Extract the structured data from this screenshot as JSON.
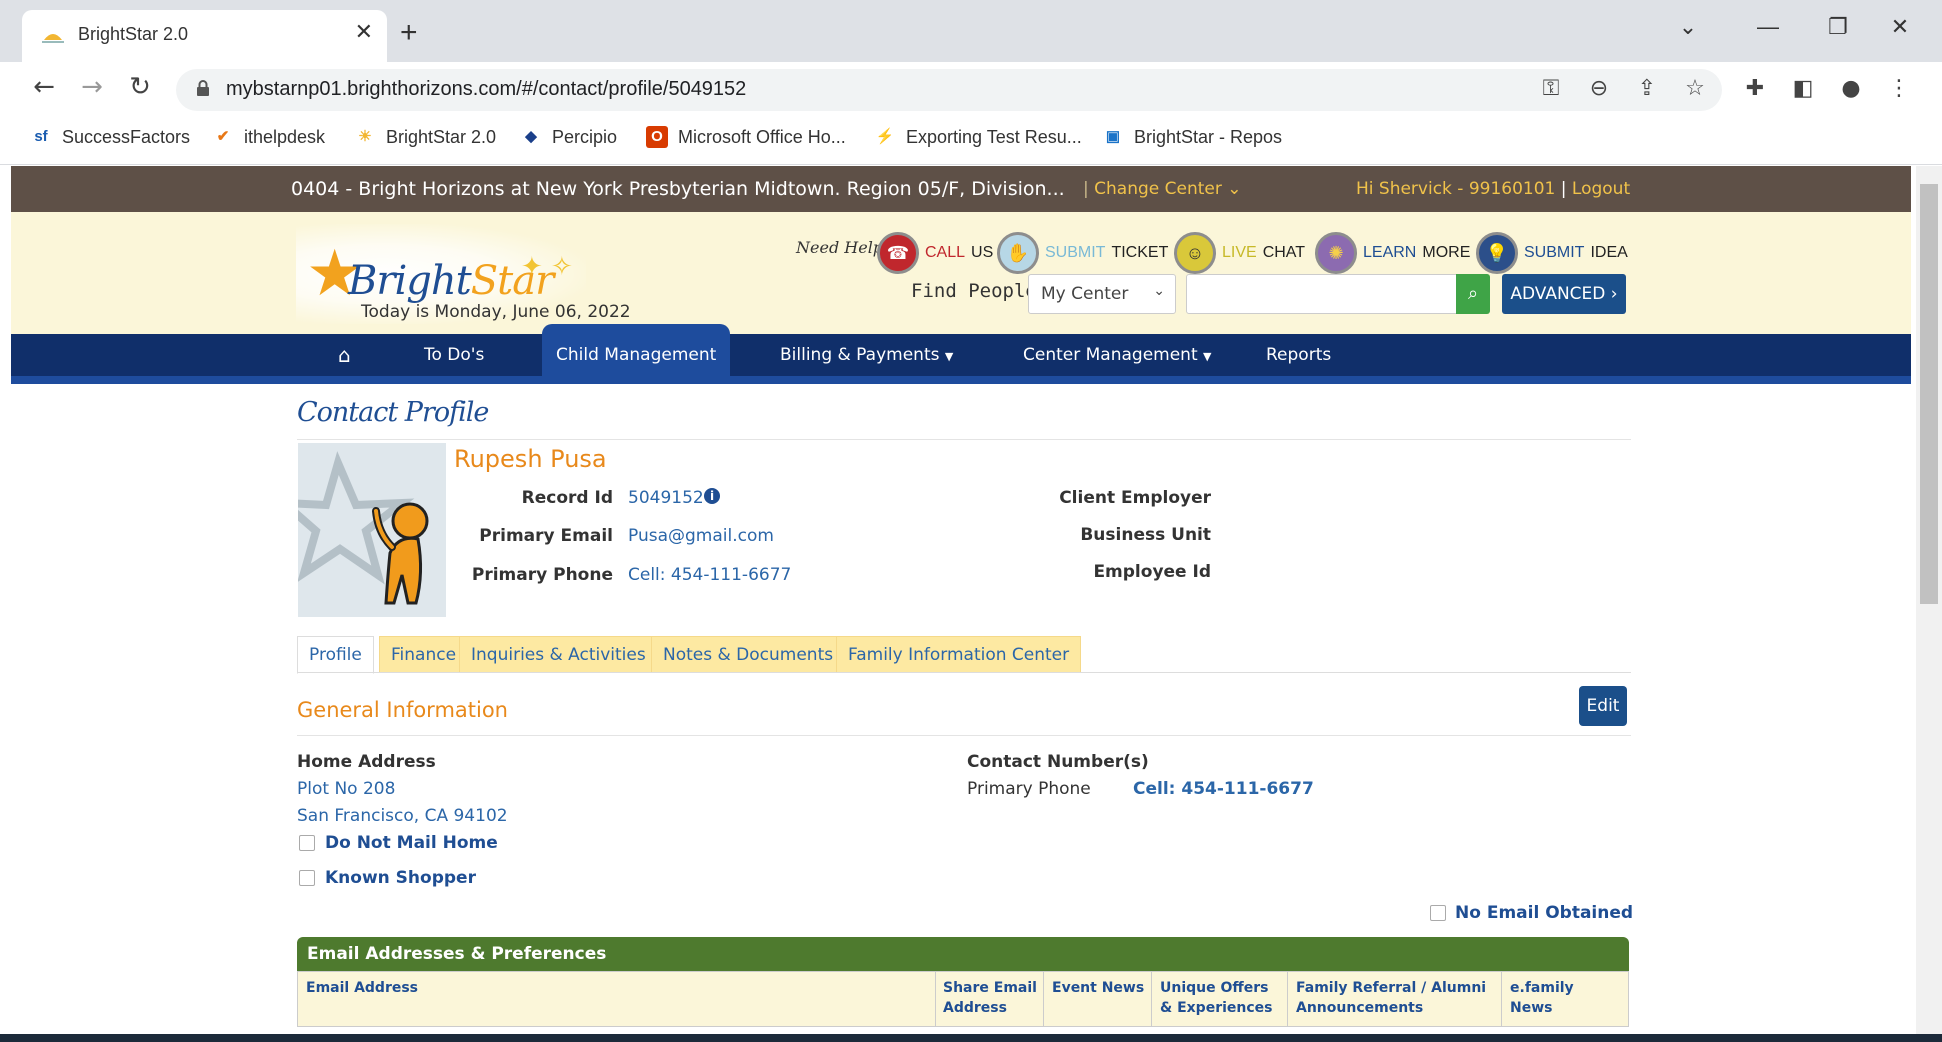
{
  "browser": {
    "tab_title": "BrightStar 2.0",
    "url": "mybstarnp01.brighthorizons.com/#/contact/profile/5049152",
    "bookmarks": [
      {
        "label": "SuccessFactors",
        "icon": "sf"
      },
      {
        "label": "ithelpdesk",
        "icon": "✔"
      },
      {
        "label": "BrightStar 2.0",
        "icon": "☀"
      },
      {
        "label": "Percipio",
        "icon": "◆"
      },
      {
        "label": "Microsoft Office Ho...",
        "icon": "O"
      },
      {
        "label": "Exporting Test Resu...",
        "icon": "⚡"
      },
      {
        "label": "BrightStar - Repos",
        "icon": "▣"
      }
    ]
  },
  "topbar": {
    "center": "0404 - Bright Horizons at New York Presbyterian Midtown. Region 05/F, Division...",
    "change_center": "Change Center",
    "greeting": "Hi Shervick - 99160101",
    "logout": "Logout"
  },
  "header": {
    "logo_bright": "Bright",
    "logo_star": "Star",
    "today": "Today is Monday, June 06, 2022",
    "need_help": "Need Help?",
    "help_links": [
      {
        "a": "CALL",
        "b": "US",
        "icon": "phone-icon"
      },
      {
        "a": "SUBMIT",
        "b": "TICKET",
        "icon": "ticket-icon"
      },
      {
        "a": "LIVE",
        "b": "CHAT",
        "icon": "chat-icon"
      },
      {
        "a": "LEARN",
        "b": "MORE",
        "icon": "learn-icon"
      },
      {
        "a": "SUBMIT",
        "b": "IDEA",
        "icon": "lightbulb-icon"
      }
    ],
    "find_people": "Find People",
    "center_select": "My Center",
    "advanced": "ADVANCED"
  },
  "nav": {
    "items": [
      "To Do's",
      "Child Management",
      "Billing & Payments",
      "Center Management",
      "Reports"
    ],
    "active": "Child Management"
  },
  "profile": {
    "page_title": "Contact Profile",
    "name": "Rupesh Pusa",
    "record_id_label": "Record Id",
    "record_id": "5049152",
    "email_label": "Primary Email",
    "email": "Pusa@gmail.com",
    "phone_label": "Primary Phone",
    "phone": "Cell: 454-111-6677",
    "client_employer_label": "Client Employer",
    "business_unit_label": "Business Unit",
    "employee_id_label": "Employee Id",
    "tabs": [
      "Profile",
      "Finance",
      "Inquiries & Activities",
      "Notes & Documents",
      "Family Information Center"
    ],
    "active_tab": "Profile"
  },
  "general": {
    "heading": "General Information",
    "edit": "Edit",
    "home_address_label": "Home Address",
    "address_line1": "Plot No 208",
    "address_line2": "San Francisco, CA 94102",
    "do_not_mail": "Do Not Mail Home",
    "known_shopper": "Known Shopper",
    "contact_numbers_label": "Contact Number(s)",
    "primary_phone_label": "Primary Phone",
    "primary_phone_value": "Cell: 454-111-6677",
    "no_email": "No Email Obtained"
  },
  "email_table": {
    "title": "Email Addresses & Preferences",
    "columns": [
      "Email Address",
      "Share Email Address",
      "Event News",
      "Unique Offers & Experiences",
      "Family Referral / Alumni Announcements",
      "e.family News"
    ]
  }
}
